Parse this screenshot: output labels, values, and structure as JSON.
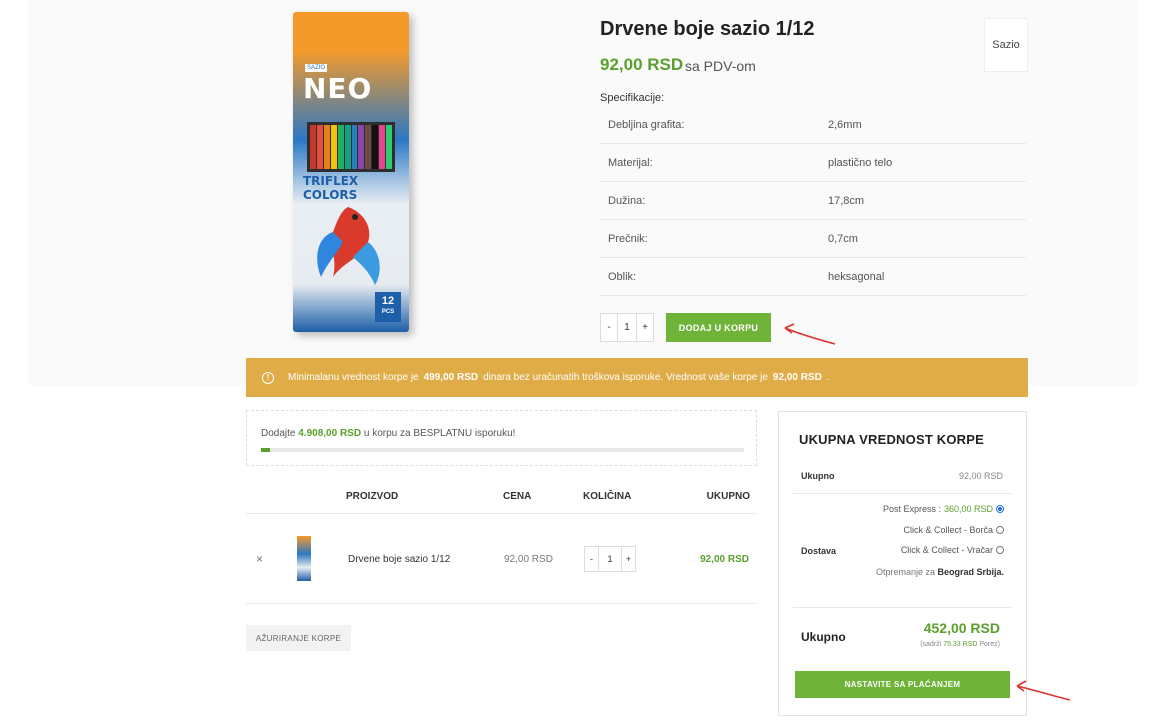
{
  "product": {
    "title": "Drvene boje sazio 1/12",
    "price": "92,00 RSD",
    "vat_note": "sa PDV-om",
    "brand": "Sazio",
    "image_texts": {
      "sazio": "SAZIO",
      "neo": "NEO",
      "triflex": "TRIFLEX COLORS",
      "pcs_count": "12",
      "pcs_label": "PCS"
    },
    "spec_label": "Specifikacije:",
    "specs": [
      {
        "key": "Debljina grafita:",
        "value": "2,6mm"
      },
      {
        "key": "Materijal:",
        "value": "plastično telo"
      },
      {
        "key": "Dužina:",
        "value": "17,8cm"
      },
      {
        "key": "Prečnik:",
        "value": "0,7cm"
      },
      {
        "key": "Oblik:",
        "value": "heksagonal"
      }
    ],
    "qty": {
      "minus": "-",
      "value": "1",
      "plus": "+"
    },
    "add_button": "DODAJ U KORPU"
  },
  "notice": {
    "icon": "info-icon",
    "part1": "Minimalanu vrednost korpe je",
    "min_value": "499,00 RSD",
    "part2": "dinara bez uračunatih troškova isporuke. Vrednost vaše korpe je",
    "cart_value": "92,00 RSD",
    "part3": "."
  },
  "free_shipping": {
    "prefix": "Dodajte",
    "amount": "4.908,00 RSD",
    "suffix": "u korpu za BESPLATNU isporuku!",
    "progress_fraction": 0.018
  },
  "cart": {
    "headers": {
      "product": "PROIZVOD",
      "price": "CENA",
      "qty": "KOLIČINA",
      "total": "UKUPNO"
    },
    "rows": [
      {
        "remove": "×",
        "name": "Drvene boje sazio 1/12",
        "price": "92,00 RSD",
        "qty_minus": "-",
        "qty": "1",
        "qty_plus": "+",
        "total": "92,00 RSD"
      }
    ],
    "update_button": "AŽURIRANJE KORPE"
  },
  "totals": {
    "title": "UKUPNA VREDNOST KORPE",
    "subtotal_label": "Ukupno",
    "subtotal_value": "92,00 RSD",
    "shipping_label": "Dostava",
    "shipping_options": [
      {
        "label": "Post Express :",
        "price": "360,00 RSD",
        "selected": true
      },
      {
        "label": "Click & Collect - Borča",
        "price": "",
        "selected": false
      },
      {
        "label": "Click & Collect - Vračar",
        "price": "",
        "selected": false
      }
    ],
    "ship_note_prefix": "Otpremanje za",
    "ship_note_city": "Beograd Srbija.",
    "grand_label": "Ukupno",
    "grand_value": "452,00 RSD",
    "tax_prefix": "(sadrži",
    "tax_value": "75,33 RSD",
    "tax_suffix": "Porez)",
    "checkout_button": "NASTAVITE SA PLAĆANJEM"
  },
  "colors": {
    "accent_green": "#6fb338",
    "notice_bg": "#e0ac48",
    "arrow_red": "#d9342b"
  }
}
